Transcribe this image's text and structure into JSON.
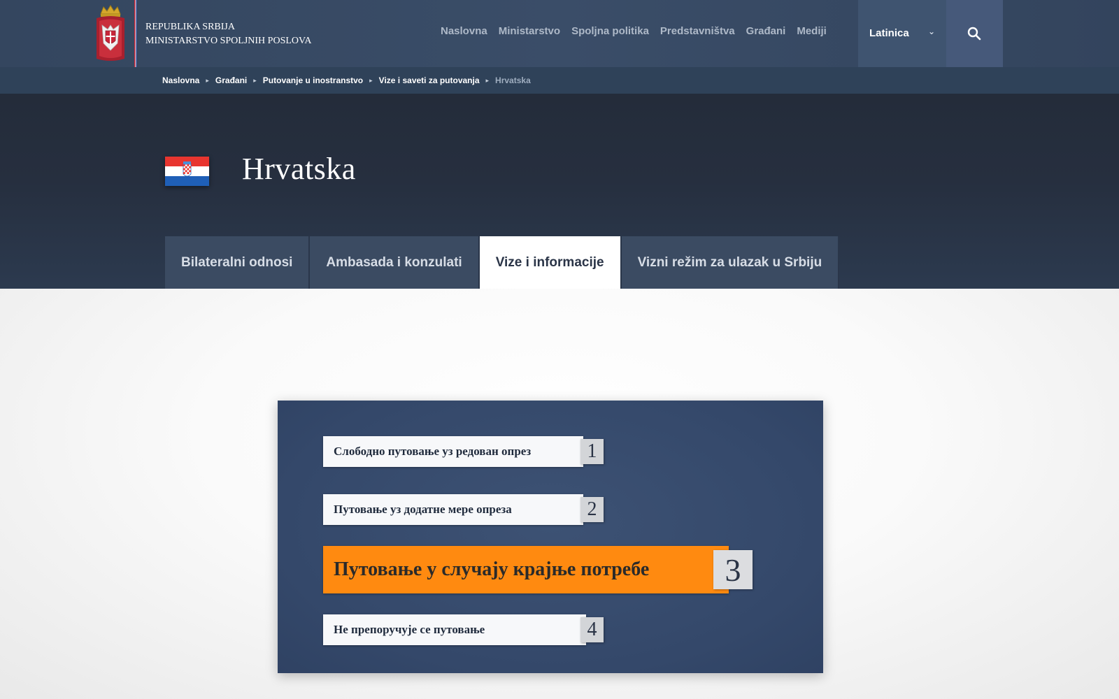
{
  "header": {
    "brand_line1": "REPUBLIKA SRBIJA",
    "brand_line2": "MINISTARSTVO SPOLJNIH POSLOVA",
    "nav": [
      "Naslovna",
      "Ministarstvo",
      "Spoljna politika",
      "Predstavništva",
      "Građani",
      "Mediji"
    ],
    "language": "Latinica",
    "icons": {
      "logo": "serbian-coat-of-arms-icon",
      "search": "search-icon",
      "language_toggle": "chevron-down-icon"
    }
  },
  "breadcrumb": {
    "items": [
      "Naslovna",
      "Građani",
      "Putovanje u inostranstvo",
      "Vize i saveti za putovanja",
      "Hrvatska"
    ]
  },
  "hero": {
    "title": "Hrvatska",
    "flag_icon": "croatia-flag-icon",
    "tabs": [
      "Bilateralni odnosi",
      "Ambasada i konzulati",
      "Vize i informacije",
      "Vizni režim za ulazak u Srbiju"
    ],
    "active_tab": "Vize i informacije"
  },
  "advisory": {
    "levels": [
      {
        "number": "1",
        "text": "Слободно путовање уз редован опрез"
      },
      {
        "number": "2",
        "text": "Путовање уз додатне мере опреза"
      },
      {
        "number": "3",
        "text": "Путовање у случају крајње потребе"
      },
      {
        "number": "4",
        "text": "Не препоручује се путовање"
      }
    ],
    "highlighted_level": "3",
    "highlight_color": "#ff8a10"
  }
}
